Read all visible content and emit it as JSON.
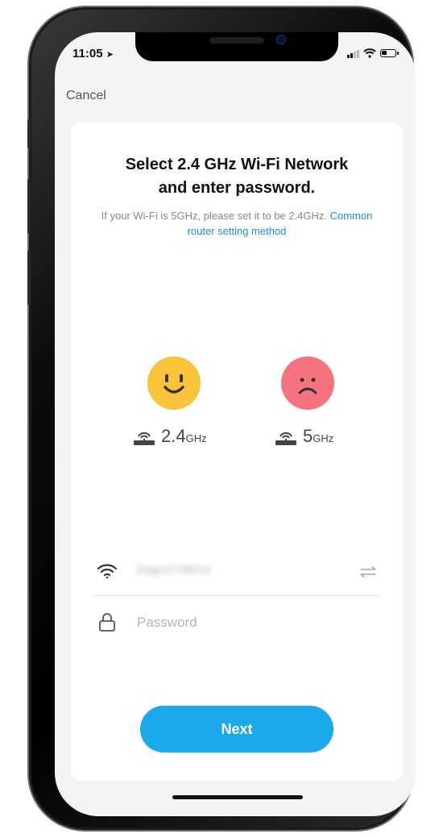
{
  "status_bar": {
    "time": "11:05"
  },
  "nav": {
    "cancel_label": "Cancel"
  },
  "content": {
    "title_line1": "Select 2.4 GHz Wi-Fi Network",
    "title_line2": "and enter password.",
    "subtitle_text": "If your Wi-Fi is 5GHz, please set it to be 2.4GHz.",
    "subtitle_link": "Common router setting method"
  },
  "bands": [
    {
      "value": "2.4",
      "unit": "GHz",
      "status": "supported",
      "face": "happy",
      "color": "#f9c33a"
    },
    {
      "value": "5",
      "unit": "GHz",
      "status": "unsupported",
      "face": "sad",
      "color": "#f4737f"
    }
  ],
  "form": {
    "ssid": "Ziggo2708011",
    "password_placeholder": "Password",
    "next_label": "Next"
  },
  "colors": {
    "accent": "#1aa9ea",
    "link": "#1a8cf0"
  }
}
